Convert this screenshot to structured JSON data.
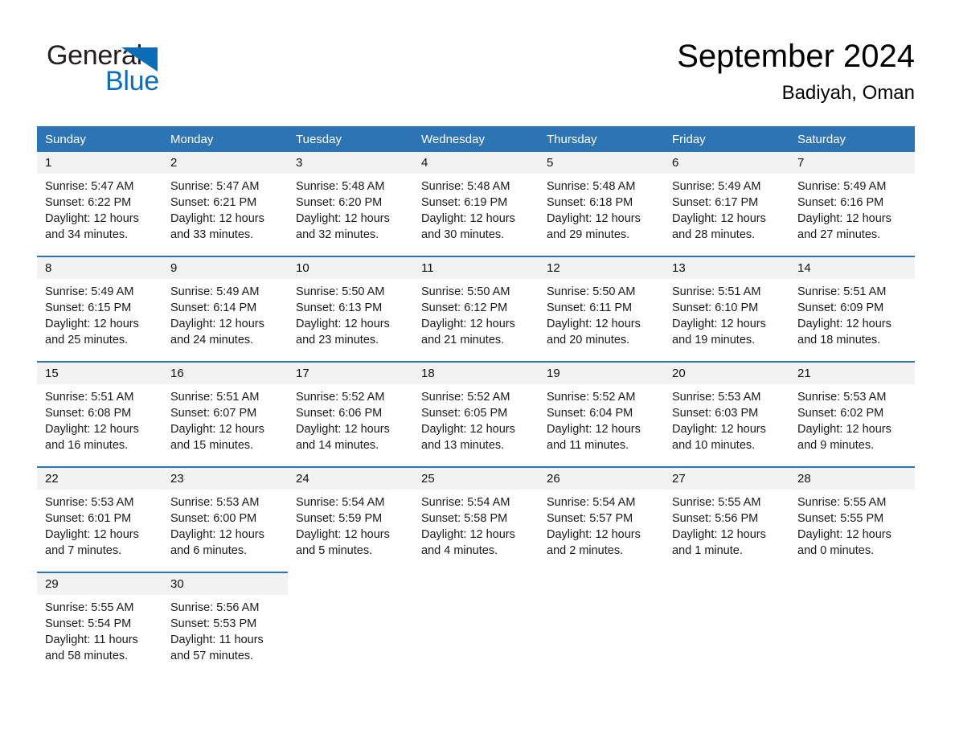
{
  "brand": {
    "name_part1": "General",
    "name_part2": "Blue",
    "triangle_color": "#0b6cb8",
    "text_color": "#231f20"
  },
  "header": {
    "month_title": "September 2024",
    "location": "Badiyah, Oman"
  },
  "colors": {
    "header_blue": "#2d74b5",
    "daynum_bg": "#f2f2f2",
    "week_divider": "#2d74b5",
    "text": "#1a1a1a"
  },
  "weekday_headers": [
    "Sunday",
    "Monday",
    "Tuesday",
    "Wednesday",
    "Thursday",
    "Friday",
    "Saturday"
  ],
  "weeks": [
    [
      {
        "day": "1",
        "sunrise": "Sunrise: 5:47 AM",
        "sunset": "Sunset: 6:22 PM",
        "daylight_line1": "Daylight: 12 hours",
        "daylight_line2": "and 34 minutes."
      },
      {
        "day": "2",
        "sunrise": "Sunrise: 5:47 AM",
        "sunset": "Sunset: 6:21 PM",
        "daylight_line1": "Daylight: 12 hours",
        "daylight_line2": "and 33 minutes."
      },
      {
        "day": "3",
        "sunrise": "Sunrise: 5:48 AM",
        "sunset": "Sunset: 6:20 PM",
        "daylight_line1": "Daylight: 12 hours",
        "daylight_line2": "and 32 minutes."
      },
      {
        "day": "4",
        "sunrise": "Sunrise: 5:48 AM",
        "sunset": "Sunset: 6:19 PM",
        "daylight_line1": "Daylight: 12 hours",
        "daylight_line2": "and 30 minutes."
      },
      {
        "day": "5",
        "sunrise": "Sunrise: 5:48 AM",
        "sunset": "Sunset: 6:18 PM",
        "daylight_line1": "Daylight: 12 hours",
        "daylight_line2": "and 29 minutes."
      },
      {
        "day": "6",
        "sunrise": "Sunrise: 5:49 AM",
        "sunset": "Sunset: 6:17 PM",
        "daylight_line1": "Daylight: 12 hours",
        "daylight_line2": "and 28 minutes."
      },
      {
        "day": "7",
        "sunrise": "Sunrise: 5:49 AM",
        "sunset": "Sunset: 6:16 PM",
        "daylight_line1": "Daylight: 12 hours",
        "daylight_line2": "and 27 minutes."
      }
    ],
    [
      {
        "day": "8",
        "sunrise": "Sunrise: 5:49 AM",
        "sunset": "Sunset: 6:15 PM",
        "daylight_line1": "Daylight: 12 hours",
        "daylight_line2": "and 25 minutes."
      },
      {
        "day": "9",
        "sunrise": "Sunrise: 5:49 AM",
        "sunset": "Sunset: 6:14 PM",
        "daylight_line1": "Daylight: 12 hours",
        "daylight_line2": "and 24 minutes."
      },
      {
        "day": "10",
        "sunrise": "Sunrise: 5:50 AM",
        "sunset": "Sunset: 6:13 PM",
        "daylight_line1": "Daylight: 12 hours",
        "daylight_line2": "and 23 minutes."
      },
      {
        "day": "11",
        "sunrise": "Sunrise: 5:50 AM",
        "sunset": "Sunset: 6:12 PM",
        "daylight_line1": "Daylight: 12 hours",
        "daylight_line2": "and 21 minutes."
      },
      {
        "day": "12",
        "sunrise": "Sunrise: 5:50 AM",
        "sunset": "Sunset: 6:11 PM",
        "daylight_line1": "Daylight: 12 hours",
        "daylight_line2": "and 20 minutes."
      },
      {
        "day": "13",
        "sunrise": "Sunrise: 5:51 AM",
        "sunset": "Sunset: 6:10 PM",
        "daylight_line1": "Daylight: 12 hours",
        "daylight_line2": "and 19 minutes."
      },
      {
        "day": "14",
        "sunrise": "Sunrise: 5:51 AM",
        "sunset": "Sunset: 6:09 PM",
        "daylight_line1": "Daylight: 12 hours",
        "daylight_line2": "and 18 minutes."
      }
    ],
    [
      {
        "day": "15",
        "sunrise": "Sunrise: 5:51 AM",
        "sunset": "Sunset: 6:08 PM",
        "daylight_line1": "Daylight: 12 hours",
        "daylight_line2": "and 16 minutes."
      },
      {
        "day": "16",
        "sunrise": "Sunrise: 5:51 AM",
        "sunset": "Sunset: 6:07 PM",
        "daylight_line1": "Daylight: 12 hours",
        "daylight_line2": "and 15 minutes."
      },
      {
        "day": "17",
        "sunrise": "Sunrise: 5:52 AM",
        "sunset": "Sunset: 6:06 PM",
        "daylight_line1": "Daylight: 12 hours",
        "daylight_line2": "and 14 minutes."
      },
      {
        "day": "18",
        "sunrise": "Sunrise: 5:52 AM",
        "sunset": "Sunset: 6:05 PM",
        "daylight_line1": "Daylight: 12 hours",
        "daylight_line2": "and 13 minutes."
      },
      {
        "day": "19",
        "sunrise": "Sunrise: 5:52 AM",
        "sunset": "Sunset: 6:04 PM",
        "daylight_line1": "Daylight: 12 hours",
        "daylight_line2": "and 11 minutes."
      },
      {
        "day": "20",
        "sunrise": "Sunrise: 5:53 AM",
        "sunset": "Sunset: 6:03 PM",
        "daylight_line1": "Daylight: 12 hours",
        "daylight_line2": "and 10 minutes."
      },
      {
        "day": "21",
        "sunrise": "Sunrise: 5:53 AM",
        "sunset": "Sunset: 6:02 PM",
        "daylight_line1": "Daylight: 12 hours",
        "daylight_line2": "and 9 minutes."
      }
    ],
    [
      {
        "day": "22",
        "sunrise": "Sunrise: 5:53 AM",
        "sunset": "Sunset: 6:01 PM",
        "daylight_line1": "Daylight: 12 hours",
        "daylight_line2": "and 7 minutes."
      },
      {
        "day": "23",
        "sunrise": "Sunrise: 5:53 AM",
        "sunset": "Sunset: 6:00 PM",
        "daylight_line1": "Daylight: 12 hours",
        "daylight_line2": "and 6 minutes."
      },
      {
        "day": "24",
        "sunrise": "Sunrise: 5:54 AM",
        "sunset": "Sunset: 5:59 PM",
        "daylight_line1": "Daylight: 12 hours",
        "daylight_line2": "and 5 minutes."
      },
      {
        "day": "25",
        "sunrise": "Sunrise: 5:54 AM",
        "sunset": "Sunset: 5:58 PM",
        "daylight_line1": "Daylight: 12 hours",
        "daylight_line2": "and 4 minutes."
      },
      {
        "day": "26",
        "sunrise": "Sunrise: 5:54 AM",
        "sunset": "Sunset: 5:57 PM",
        "daylight_line1": "Daylight: 12 hours",
        "daylight_line2": "and 2 minutes."
      },
      {
        "day": "27",
        "sunrise": "Sunrise: 5:55 AM",
        "sunset": "Sunset: 5:56 PM",
        "daylight_line1": "Daylight: 12 hours",
        "daylight_line2": "and 1 minute."
      },
      {
        "day": "28",
        "sunrise": "Sunrise: 5:55 AM",
        "sunset": "Sunset: 5:55 PM",
        "daylight_line1": "Daylight: 12 hours",
        "daylight_line2": "and 0 minutes."
      }
    ],
    [
      {
        "day": "29",
        "sunrise": "Sunrise: 5:55 AM",
        "sunset": "Sunset: 5:54 PM",
        "daylight_line1": "Daylight: 11 hours",
        "daylight_line2": "and 58 minutes."
      },
      {
        "day": "30",
        "sunrise": "Sunrise: 5:56 AM",
        "sunset": "Sunset: 5:53 PM",
        "daylight_line1": "Daylight: 11 hours",
        "daylight_line2": "and 57 minutes."
      },
      null,
      null,
      null,
      null,
      null
    ]
  ]
}
